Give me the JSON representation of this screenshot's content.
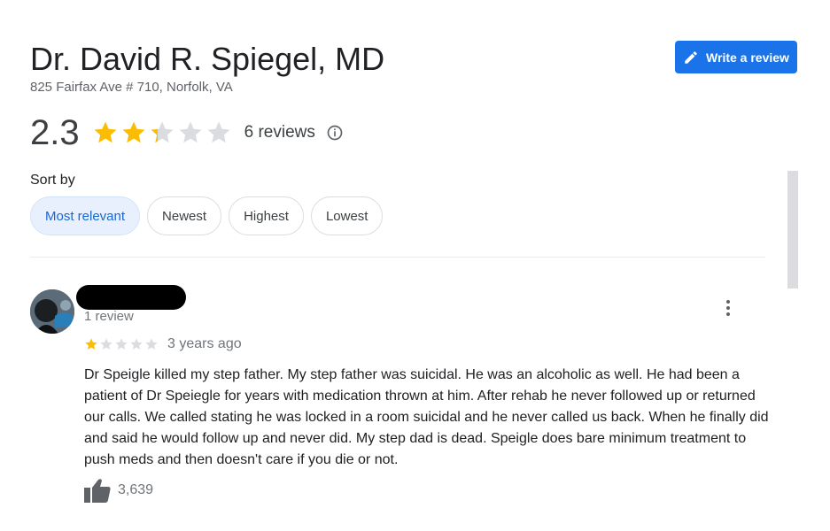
{
  "header": {
    "title": "Dr. David R. Spiegel, MD",
    "address": "825 Fairfax Ave # 710, Norfolk, VA",
    "write_review_label": "Write a review"
  },
  "rating": {
    "average": "2.3",
    "average_value": 2.3,
    "max_stars": 5,
    "count_label": "6 reviews",
    "star_color": "#fbbc04",
    "star_empty_color": "#dadce0"
  },
  "sort": {
    "label": "Sort by",
    "options": [
      "Most relevant",
      "Newest",
      "Highest",
      "Lowest"
    ],
    "selected": "Most relevant"
  },
  "review": {
    "reviewer_meta": "1 review",
    "rating_value": 1,
    "time": "3 years ago",
    "text": "Dr Speigle killed my step father. My step father was suicidal. He was an alcoholic as well. He had been a patient of Dr Speiegle for years with medication thrown at him. After rehab he never followed up or returned our calls. We called stating he was locked in a room suicidal and he never called us back. When he finally did and said he would follow up and never did.  My step dad is dead. Speigle does bare minimum treatment to push meds and then doesn't care if you die or not.",
    "likes": "3,639"
  },
  "colors": {
    "accent": "#1a73e8",
    "chip_selected_bg": "#e8f0fe",
    "chip_selected_text": "#1967d2"
  },
  "icons": {
    "write": "pencil-icon",
    "info": "info-icon",
    "more": "more-vert-icon",
    "like": "thumb-up-icon"
  }
}
